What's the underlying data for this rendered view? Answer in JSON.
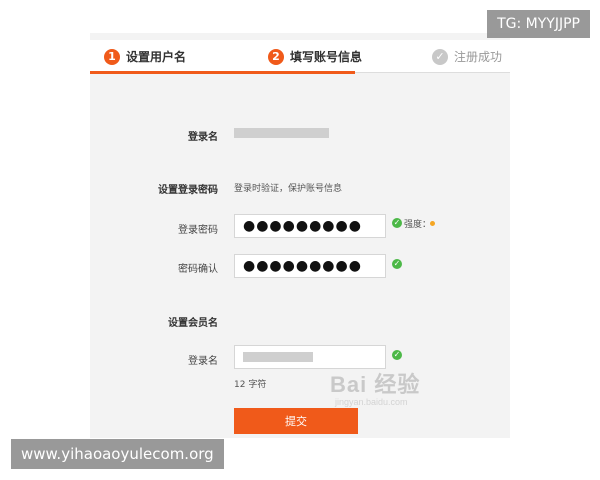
{
  "watermarks": {
    "tg": "TG: MYYJJPP",
    "site": "www.yihaoaoyulecom.org",
    "baidu": "Bai 经验",
    "baidu_url": "jingyan.baidu.com"
  },
  "steps": [
    {
      "num": "1",
      "label": "设置用户名"
    },
    {
      "num": "2",
      "label": "填写账号信息"
    },
    {
      "num": "✓",
      "label": "注册成功"
    }
  ],
  "form": {
    "login_name_label": "登录名",
    "set_password_label": "设置登录密码",
    "set_password_hint": "登录时验证，保护账号信息",
    "password_label": "登录密码",
    "password_value": "●●●●●●●●●",
    "strength_label": "强度：",
    "confirm_label": "密码确认",
    "confirm_value": "●●●●●●●●●",
    "member_section": "设置会员名",
    "member_label": "登录名",
    "char_count": "12 字符",
    "submit_label": "提交"
  },
  "colors": {
    "accent": "#f05a1a",
    "ok": "#4cb847"
  }
}
